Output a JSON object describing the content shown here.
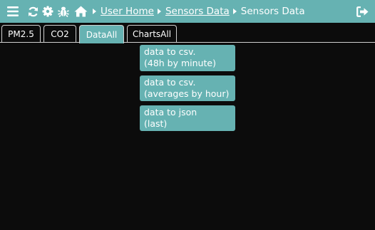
{
  "header": {
    "icons": [
      "hamburger-menu-icon",
      "refresh-icon",
      "gear-icon",
      "bug-icon",
      "home-icon",
      "logout-icon"
    ],
    "breadcrumb": {
      "items": [
        {
          "label": "User Home",
          "link": true
        },
        {
          "label": "Sensors Data",
          "link": true
        },
        {
          "label": "Sensors Data",
          "link": false
        }
      ]
    }
  },
  "tabs": [
    {
      "label": "PM2.5",
      "active": false
    },
    {
      "label": "CO2",
      "active": false
    },
    {
      "label": "DataAll",
      "active": true
    },
    {
      "label": "ChartsAll",
      "active": false
    }
  ],
  "actions": [
    {
      "line1": "data to csv.",
      "line2": "(48h by minute)"
    },
    {
      "line1": "data to csv.",
      "line2": "(averages by hour)"
    },
    {
      "line1": "data to json",
      "line2": "(last)"
    }
  ],
  "colors": {
    "accent": "#66b2b2",
    "background": "#0c0c0c",
    "text": "#ffffff"
  }
}
